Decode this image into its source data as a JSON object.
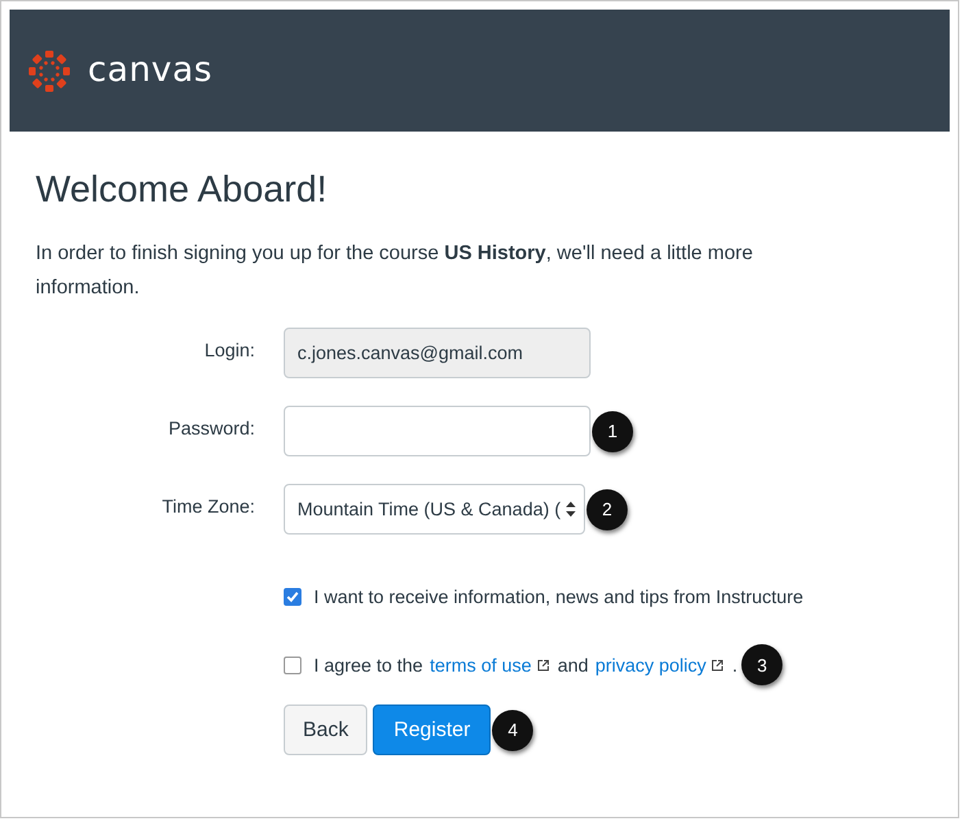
{
  "header": {
    "logo_text": "canvas"
  },
  "title": "Welcome Aboard!",
  "intro": "In order to finish signing you up for the course **US History**, we'll need a little more information.",
  "fields": [
    {
      "kind": "text",
      "label": "Login:",
      "value": "c.jones.canvas@gmail.com",
      "disabled": true
    },
    {
      "kind": "password",
      "label": "Password:",
      "disabled": false,
      "callout": "1"
    },
    {
      "kind": "select",
      "label": "Time Zone:",
      "value": "Mountain Time (US & Canada) (",
      "disabled": false,
      "callout": "2"
    }
  ],
  "checkboxes": [
    {
      "kind": "plain",
      "text": "I want to receive information, news and tips from Instructure",
      "checked": true
    },
    {
      "kind": "terms",
      "before": "I agree to the",
      "link1": "terms of use",
      "middle": "and",
      "link2": "privacy policy",
      "after": ".",
      "checked": false,
      "callout": "3"
    }
  ],
  "buttons": [
    {
      "label": "Back",
      "kind": "secondary"
    },
    {
      "label": "Register",
      "kind": "primary",
      "callout": "4"
    }
  ]
}
